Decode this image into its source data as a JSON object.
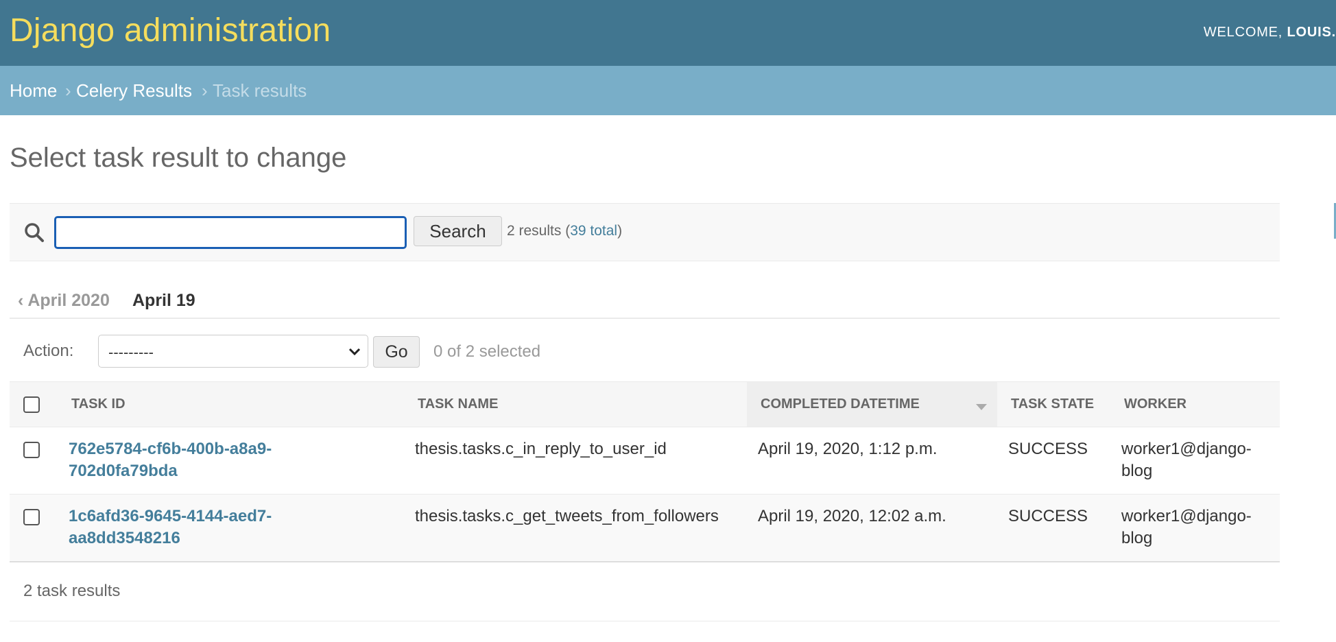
{
  "header": {
    "site_title": "Django administration",
    "welcome_prefix": "WELCOME, ",
    "username": "LOUIS."
  },
  "breadcrumbs": {
    "items": [
      {
        "label": "Home"
      },
      {
        "label": "Celery Results"
      },
      {
        "label": "Task results"
      }
    ],
    "separator": "›"
  },
  "page": {
    "title": "Select task result to change"
  },
  "search": {
    "value": "",
    "placeholder": "",
    "button_label": "Search",
    "result_prefix": "2 results (",
    "total_link": "39 total",
    "result_suffix": ")"
  },
  "date_hierarchy": {
    "back_label": "‹ April 2020",
    "current_label": "April 19"
  },
  "actions": {
    "label": "Action:",
    "selected_option": "---------",
    "go_label": "Go",
    "counter": "0 of 2 selected"
  },
  "table": {
    "columns": [
      "TASK ID",
      "TASK NAME",
      "COMPLETED DATETIME",
      "TASK STATE",
      "WORKER"
    ],
    "sorted_column": "COMPLETED DATETIME",
    "sort_direction": "descending",
    "rows": [
      {
        "task_id": "762e5784-cf6b-400b-a8a9-702d0fa79bda",
        "task_id_line1": "762e5784-cf6b-400b-a8a9-",
        "task_id_line2": "702d0fa79bda",
        "task_name": "thesis.tasks.c_in_reply_to_user_id",
        "completed": "April 19, 2020, 1:12 p.m.",
        "state": "SUCCESS",
        "worker_line1": "worker1@django-",
        "worker_line2": "blog"
      },
      {
        "task_id": "1c6afd36-9645-4144-aed7-aa8dd3548216",
        "task_id_line1": "1c6afd36-9645-4144-aed7-",
        "task_id_line2": "aa8dd3548216",
        "task_name": "thesis.tasks.c_get_tweets_from_followers",
        "completed": "April 19, 2020, 12:02 a.m.",
        "state": "SUCCESS",
        "worker_line1": "worker1@django-",
        "worker_line2": "blog"
      }
    ]
  },
  "paginator": {
    "text": "2 task results"
  },
  "colors": {
    "header_bg": "#417690",
    "breadcrumb_bg": "#79aec8",
    "title_yellow": "#f5dd5d",
    "link_blue": "#447e9b"
  }
}
